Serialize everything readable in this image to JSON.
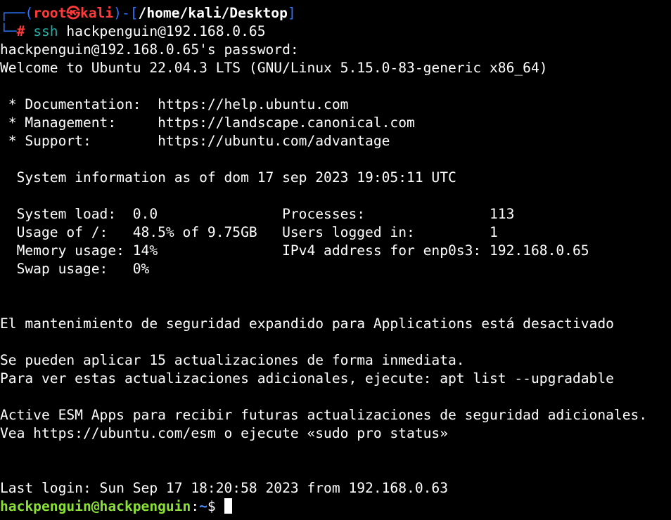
{
  "prompt": {
    "corner_top": "┌──(",
    "user": "root",
    "skull": "㉿",
    "host": "kali",
    "mid": ")-[",
    "path": "/home/kali/Desktop",
    "end": "]",
    "corner_bottom": "└─",
    "hash": "#",
    "cmd": "ssh",
    "arg": "hackpenguin@192.168.0.65"
  },
  "lines": {
    "password": "hackpenguin@192.168.0.65's password:",
    "welcome": "Welcome to Ubuntu 22.04.3 LTS (GNU/Linux 5.15.0-83-generic x86_64)",
    "doc": " * Documentation:  https://help.ubuntu.com",
    "mgmt": " * Management:     https://landscape.canonical.com",
    "support": " * Support:        https://ubuntu.com/advantage",
    "sysinfo": "  System information as of dom 17 sep 2023 19:05:11 UTC",
    "load": "  System load:  0.0               Processes:               113",
    "usage": "  Usage of /:   48.5% of 9.75GB   Users logged in:         1",
    "mem": "  Memory usage: 14%               IPv4 address for enp0s3: 192.168.0.65",
    "swap": "  Swap usage:   0%",
    "esm_maint": "El mantenimiento de seguridad expandido para Applications está desactivado",
    "updates1": "Se pueden aplicar 15 actualizaciones de forma inmediata.",
    "updates2": "Para ver estas actualizaciones adicionales, ejecute: apt list --upgradable",
    "esm_apps1": "Active ESM Apps para recibir futuras actualizaciones de seguridad adicionales.",
    "esm_apps2": "Vea https://ubuntu.com/esm o ejecute «sudo pro status»",
    "last_login": "Last login: Sun Sep 17 18:20:58 2023 from 192.168.0.63"
  },
  "remote_prompt": {
    "userhost": "hackpenguin@hackpenguin",
    "colon": ":",
    "path": "~",
    "dollar": "$ "
  },
  "colors": {
    "background": "#000000",
    "prompt_frame": "#2e74ff",
    "root_user": "#ff3a3a",
    "command": "#20b2aa",
    "remote_prompt": "#8ae234"
  }
}
